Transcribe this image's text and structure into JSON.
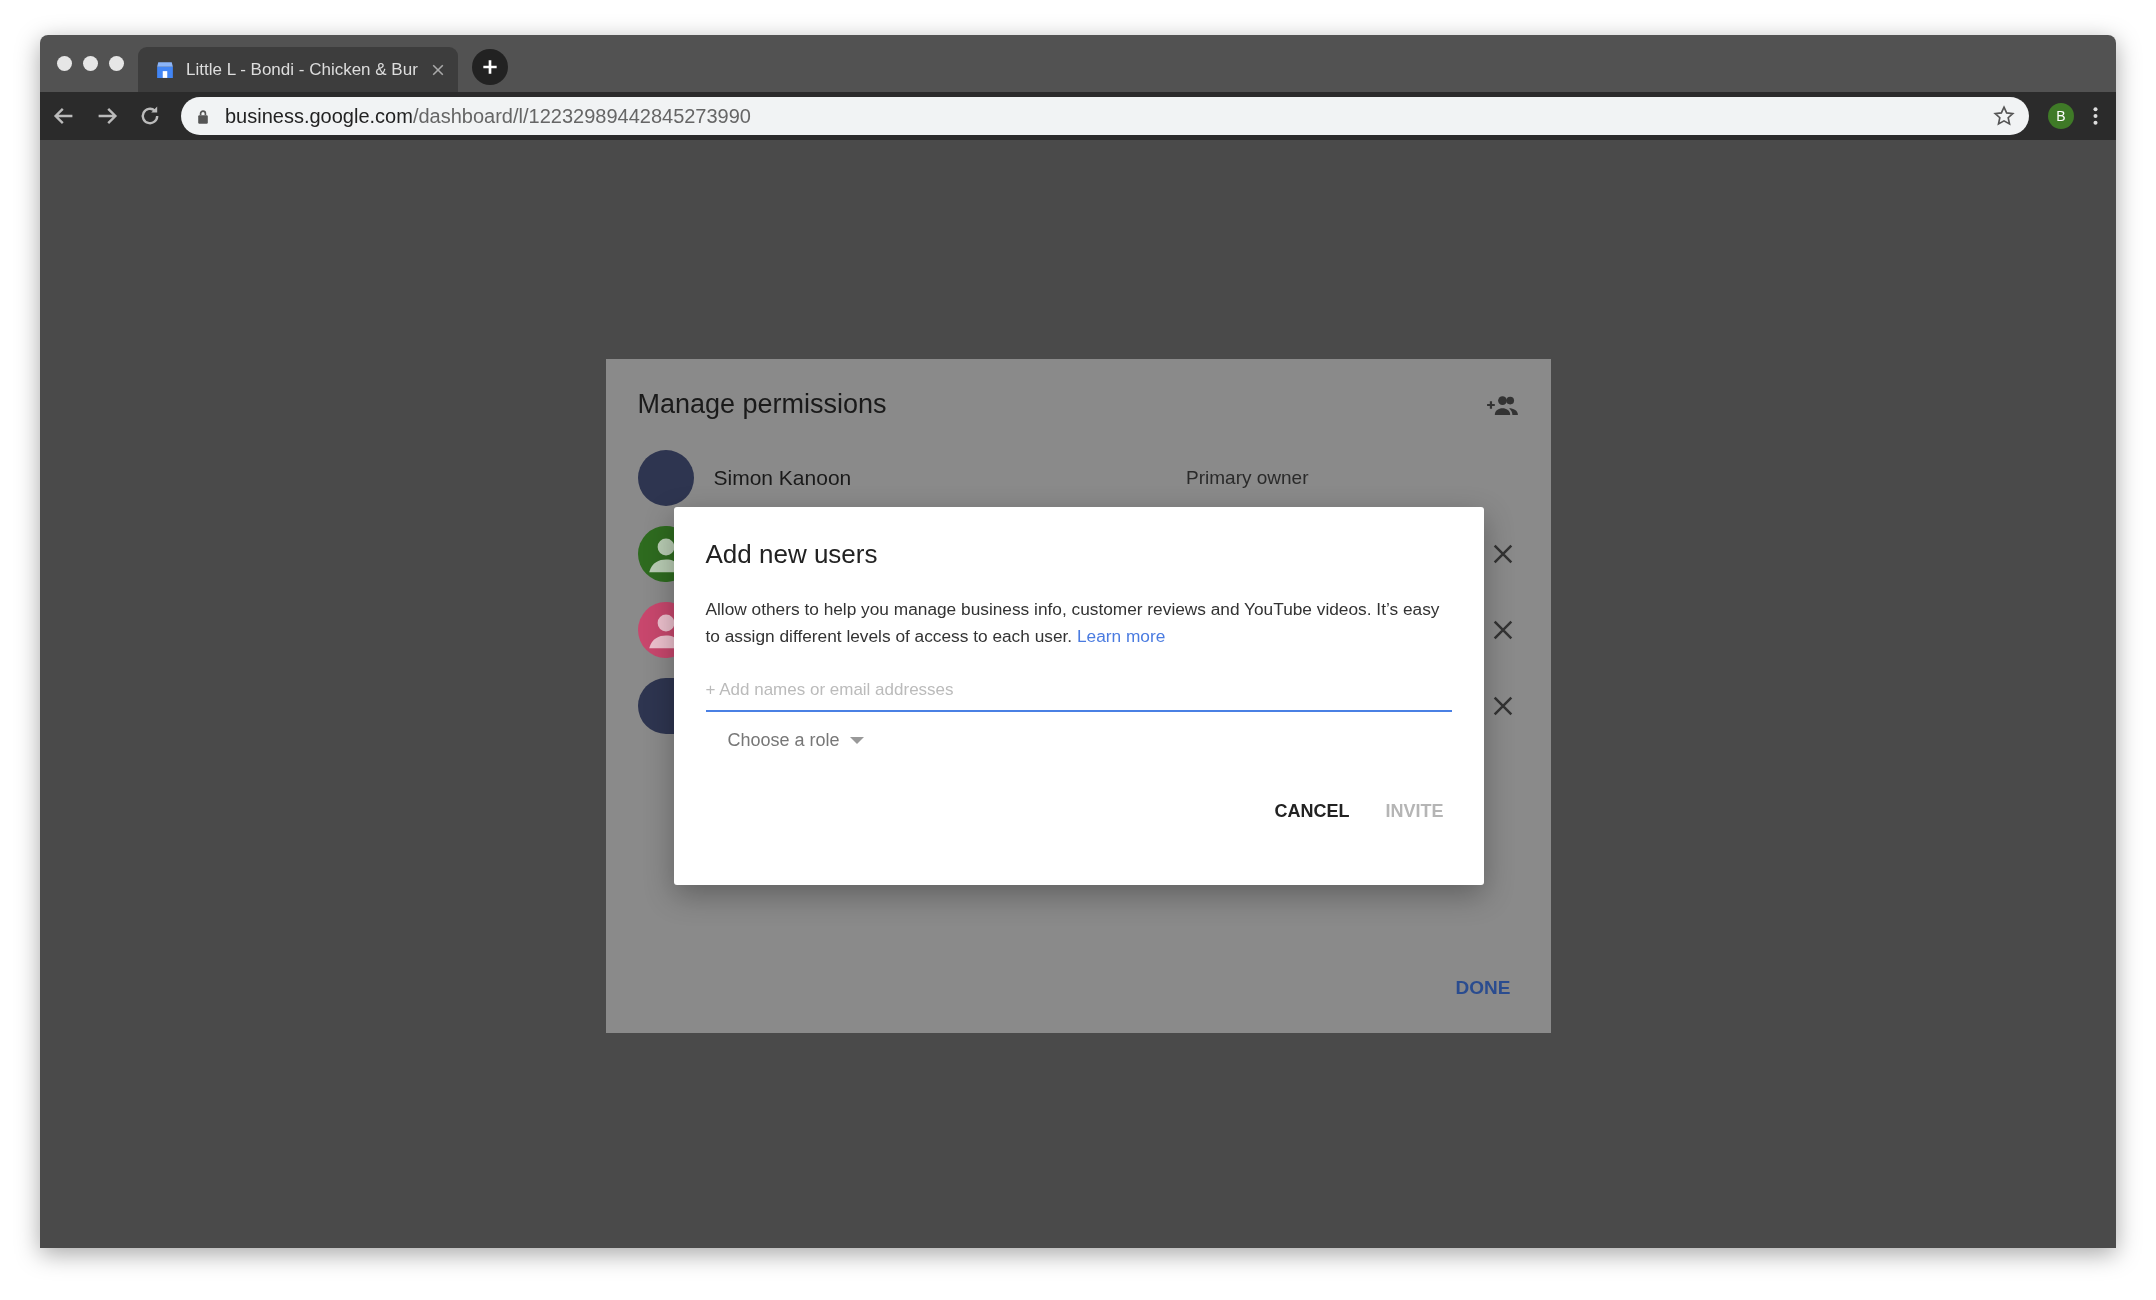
{
  "browser": {
    "tab": {
      "title": "Little L - Bondi - Chicken & Bur"
    },
    "url": {
      "host": "business.google.com",
      "path": "/dashboard/l/12232989442845273990"
    },
    "profile_initial": "B"
  },
  "permissions": {
    "title": "Manage permissions",
    "users": [
      {
        "kind": "photo",
        "name": "Simon Kanoon",
        "role": "Primary owner",
        "removable": false
      },
      {
        "kind": "silhouette",
        "color": "#2e6b1f",
        "removable": true
      },
      {
        "kind": "silhouette",
        "color": "#c8476d",
        "removable": true
      },
      {
        "kind": "photo",
        "removable": true
      }
    ],
    "done": "DONE"
  },
  "dialog": {
    "title": "Add new users",
    "text": "Allow others to help you manage business info, customer reviews and YouTube videos. It’s easy to assign different levels of access to each user.",
    "link": "Learn more",
    "field": {
      "placeholder": "+ Add names or email addresses"
    },
    "role_select": "Choose a role",
    "buttons": [
      {
        "label": "CANCEL",
        "disabled": false
      },
      {
        "label": "INVITE",
        "disabled": true
      }
    ]
  }
}
